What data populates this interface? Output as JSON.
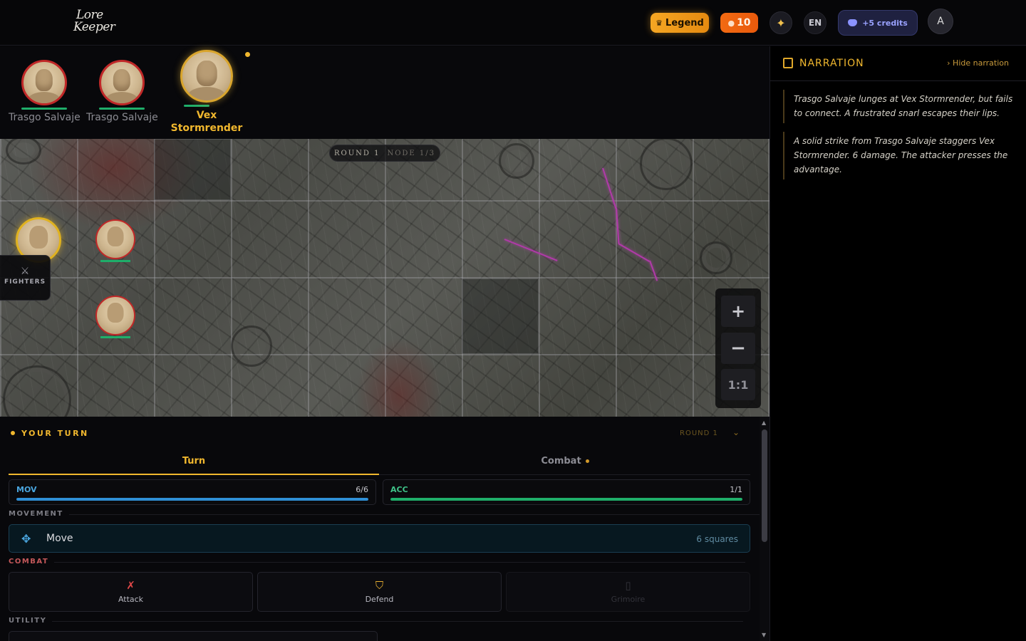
{
  "header": {
    "logo_line1": "Lore",
    "logo_line2": "Keeper",
    "legend_label": "Legend",
    "coins": "10",
    "language": "EN",
    "discord_label": "+5 credits",
    "avatar_initial": "A"
  },
  "initiative": [
    {
      "name": "Trasgo Salvaje",
      "team": "enemy"
    },
    {
      "name": "Trasgo Salvaje",
      "team": "enemy"
    },
    {
      "name": "Vex Stormrender",
      "team": "ally",
      "active": true
    }
  ],
  "map": {
    "round_label": "ROUND 1",
    "node_label": "NODE 1/3",
    "fighters_tab_label": "FIGHTERS",
    "zoom_in": "+",
    "zoom_out": "−",
    "zoom_reset": "1:1"
  },
  "narration": {
    "title": "NARRATION",
    "hide_label": "Hide narration",
    "entries": [
      "Trasgo Salvaje lunges at Vex Stormrender, but fails to connect. A frustrated snarl escapes their lips.",
      "A solid strike from Trasgo Salvaje staggers Vex Stormrender. 6 damage. The attacker presses the advantage."
    ]
  },
  "panel": {
    "turn_title": "YOUR TURN",
    "round_label": "ROUND 1",
    "tabs": [
      {
        "label": "Turn",
        "active": true
      },
      {
        "label": "Combat",
        "active": false,
        "has_dot": true
      }
    ],
    "stats": [
      {
        "name": "MOV",
        "value": "6/6",
        "fraction": 1.0,
        "color": "#2f8fd6",
        "name_color": "#4aa6df"
      },
      {
        "name": "ACC",
        "value": "1/1",
        "fraction": 1.0,
        "color": "#1fae6a",
        "name_color": "#3fc288"
      }
    ],
    "movement_label": "MOVEMENT",
    "move": {
      "label": "Move",
      "meta": "6 squares"
    },
    "combat_label": "COMBAT",
    "actions": [
      {
        "label": "Attack",
        "enabled": true,
        "icon_color": "#e04848"
      },
      {
        "label": "Defend",
        "enabled": true,
        "icon_color": "#e8b030"
      },
      {
        "label": "Grimoire",
        "enabled": false,
        "icon_color": "#33333a"
      }
    ],
    "utility_label": "UTILITY"
  }
}
